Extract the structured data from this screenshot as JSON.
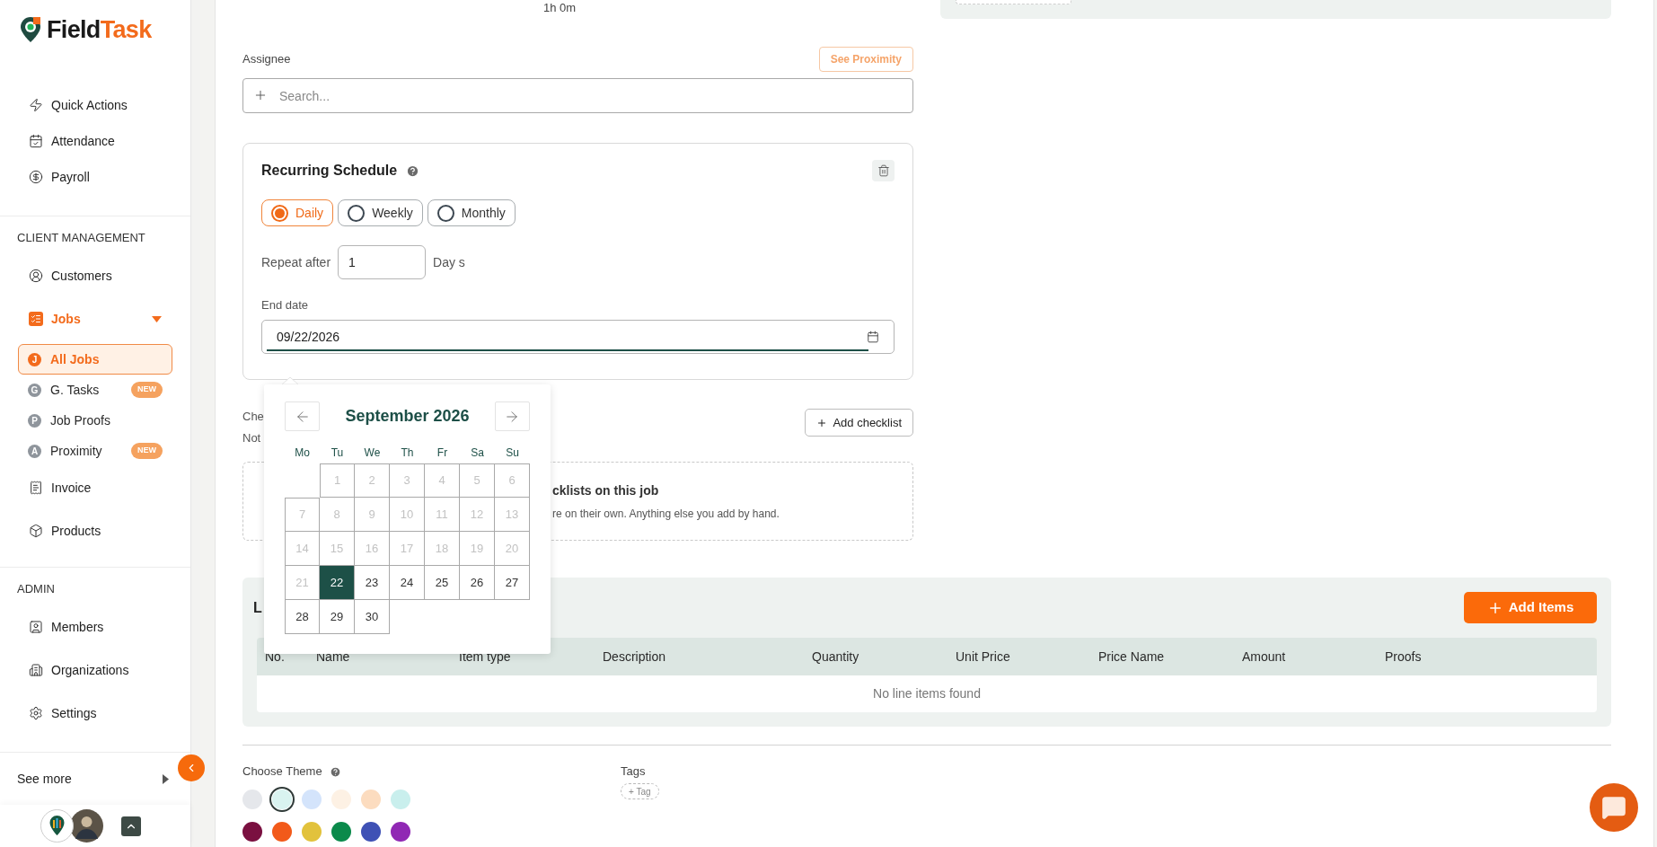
{
  "sidebar": {
    "logo": {
      "part_1": "Field",
      "part_2": "Task"
    },
    "groups": [
      {
        "items": [
          {
            "label": "Quick Actions"
          },
          {
            "label": "Attendance"
          },
          {
            "label": "Payroll"
          }
        ]
      },
      {
        "heading": "CLIENT MANAGEMENT",
        "items": [
          {
            "label": "Customers"
          },
          {
            "label": "Jobs",
            "expanded": true,
            "children": [
              {
                "label": "All Jobs",
                "letter": "J",
                "selected": true
              },
              {
                "label": "G. Tasks",
                "letter": "G",
                "selected": false,
                "badge": "NEW"
              },
              {
                "label": "Job Proofs",
                "letter": "P",
                "selected": false
              },
              {
                "label": "Proximity",
                "letter": "A",
                "selected": false,
                "badge": "NEW"
              }
            ]
          },
          {
            "label": "Invoice"
          },
          {
            "label": "Products"
          }
        ]
      },
      {
        "heading": "ADMIN",
        "items": [
          {
            "label": "Members"
          },
          {
            "label": "Organizations"
          },
          {
            "label": "Settings"
          }
        ]
      }
    ],
    "see_more": "See more"
  },
  "duration": "1h 0m",
  "assignee": {
    "label": "Assignee",
    "proximity_button": "See Proximity",
    "placeholder": "Search..."
  },
  "recurring": {
    "title": "Recurring Schedule",
    "options": [
      {
        "label": "Daily",
        "selected": true
      },
      {
        "label": "Weekly",
        "selected": false
      },
      {
        "label": "Monthly",
        "selected": false
      }
    ],
    "repeat_label": "Repeat after",
    "repeat_value": "1",
    "repeat_unit": "Day s",
    "end_date_label": "End date",
    "end_date": "09/22/2026"
  },
  "calendar": {
    "title": "September 2026",
    "weekdays": [
      "Mo",
      "Tu",
      "We",
      "Th",
      "Fr",
      "Sa",
      "Su"
    ],
    "weeks": [
      [
        {
          "kind": "blank"
        },
        {
          "kind": "day",
          "label": "1",
          "disabled": true,
          "selected": false
        },
        {
          "kind": "day",
          "label": "2",
          "disabled": true,
          "selected": false
        },
        {
          "kind": "day",
          "label": "3",
          "disabled": true,
          "selected": false
        },
        {
          "kind": "day",
          "label": "4",
          "disabled": true,
          "selected": false
        },
        {
          "kind": "day",
          "label": "5",
          "disabled": true,
          "selected": false
        },
        {
          "kind": "day",
          "label": "6",
          "disabled": true,
          "selected": false
        }
      ],
      [
        {
          "kind": "day",
          "label": "7",
          "disabled": true,
          "selected": false
        },
        {
          "kind": "day",
          "label": "8",
          "disabled": true,
          "selected": false
        },
        {
          "kind": "day",
          "label": "9",
          "disabled": true,
          "selected": false
        },
        {
          "kind": "day",
          "label": "10",
          "disabled": true,
          "selected": false
        },
        {
          "kind": "day",
          "label": "11",
          "disabled": true,
          "selected": false
        },
        {
          "kind": "day",
          "label": "12",
          "disabled": true,
          "selected": false
        },
        {
          "kind": "day",
          "label": "13",
          "disabled": true,
          "selected": false
        }
      ],
      [
        {
          "kind": "day",
          "label": "14",
          "disabled": true,
          "selected": false
        },
        {
          "kind": "day",
          "label": "15",
          "disabled": true,
          "selected": false
        },
        {
          "kind": "day",
          "label": "16",
          "disabled": true,
          "selected": false
        },
        {
          "kind": "day",
          "label": "17",
          "disabled": true,
          "selected": false
        },
        {
          "kind": "day",
          "label": "18",
          "disabled": true,
          "selected": false
        },
        {
          "kind": "day",
          "label": "19",
          "disabled": true,
          "selected": false
        },
        {
          "kind": "day",
          "label": "20",
          "disabled": true,
          "selected": false
        }
      ],
      [
        {
          "kind": "day",
          "label": "21",
          "disabled": true,
          "selected": false
        },
        {
          "kind": "day",
          "label": "22",
          "disabled": false,
          "selected": true
        },
        {
          "kind": "day",
          "label": "23",
          "disabled": false,
          "selected": false
        },
        {
          "kind": "day",
          "label": "24",
          "disabled": false,
          "selected": false
        },
        {
          "kind": "day",
          "label": "25",
          "disabled": false,
          "selected": false
        },
        {
          "kind": "day",
          "label": "26",
          "disabled": false,
          "selected": false
        },
        {
          "kind": "day",
          "label": "27",
          "disabled": false,
          "selected": false
        }
      ],
      [
        {
          "kind": "day",
          "label": "28",
          "disabled": false,
          "selected": false
        },
        {
          "kind": "day",
          "label": "29",
          "disabled": false,
          "selected": false
        },
        {
          "kind": "day",
          "label": "30",
          "disabled": false,
          "selected": false
        }
      ]
    ]
  },
  "checklists": {
    "label_fragment": "Che",
    "note_fragment": "Not",
    "add_button": "Add checklist",
    "empty_title": "cklists on this job",
    "empty_text": "re on their own. Anything else you add by hand."
  },
  "line_items": {
    "title": "L",
    "add_button": "Add Items",
    "columns": [
      "No.",
      "Name",
      "Item type",
      "Description",
      "Quantity",
      "Unit Price",
      "Price Name",
      "Amount",
      "Proofs"
    ],
    "empty": "No line items found"
  },
  "theme": {
    "label": "Choose Theme",
    "colors": [
      {
        "color": "#e5e7eb",
        "selected": false
      },
      {
        "color": "#d9f3f0",
        "selected": true
      },
      {
        "color": "#d4e4fb",
        "selected": false
      },
      {
        "color": "#fdf1e4",
        "selected": false
      },
      {
        "color": "#fcdcbf",
        "selected": false
      },
      {
        "color": "#c9efed",
        "selected": false
      },
      {
        "color": "#7a1040",
        "selected": false
      },
      {
        "color": "#f25a1a",
        "selected": false
      },
      {
        "color": "#e2c23c",
        "selected": false
      },
      {
        "color": "#0b8a4b",
        "selected": false
      },
      {
        "color": "#3f51b5",
        "selected": false
      },
      {
        "color": "#9028b4",
        "selected": false
      }
    ]
  },
  "tags": {
    "label": "Tags",
    "add": "+ Tag"
  }
}
